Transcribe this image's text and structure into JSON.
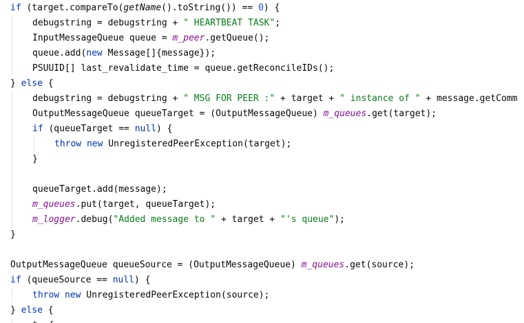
{
  "editor": {
    "lines": [
      {
        "indent": 0,
        "tokens": [
          {
            "t": "if",
            "c": "kw"
          },
          {
            "t": " (target.compareTo("
          },
          {
            "t": "getName",
            "c": "fn-italic"
          },
          {
            "t": "().toString()) == "
          },
          {
            "t": "0",
            "c": "num"
          },
          {
            "t": ") {"
          }
        ]
      },
      {
        "indent": 1,
        "tokens": [
          {
            "t": "debugstring = debugstring + "
          },
          {
            "t": "\" HEARTBEAT TASK\"",
            "c": "str"
          },
          {
            "t": ";"
          }
        ]
      },
      {
        "indent": 1,
        "tokens": [
          {
            "t": "InputMessageQueue queue = "
          },
          {
            "t": "m_peer",
            "c": "field"
          },
          {
            "t": ".getQueue();"
          }
        ]
      },
      {
        "indent": 1,
        "tokens": [
          {
            "t": "queue.add("
          },
          {
            "t": "new",
            "c": "kw"
          },
          {
            "t": " Message[]{message});"
          }
        ]
      },
      {
        "indent": 1,
        "tokens": [
          {
            "t": "PSUUID[] last_revalidate_time = queue.getReconcileIDs();"
          }
        ]
      },
      {
        "indent": 0,
        "tokens": [
          {
            "t": "} "
          },
          {
            "t": "else",
            "c": "kw"
          },
          {
            "t": " {"
          }
        ]
      },
      {
        "indent": 1,
        "tokens": [
          {
            "t": "debugstring = debugstring + "
          },
          {
            "t": "\" MSG FOR PEER :\"",
            "c": "str"
          },
          {
            "t": " + target + "
          },
          {
            "t": "\" instance of \"",
            "c": "str"
          },
          {
            "t": " + message.getComm"
          }
        ]
      },
      {
        "indent": 1,
        "tokens": [
          {
            "t": "OutputMessageQueue queueTarget = (OutputMessageQueue) "
          },
          {
            "t": "m_queues",
            "c": "field"
          },
          {
            "t": ".get(target);"
          }
        ]
      },
      {
        "indent": 1,
        "tokens": [
          {
            "t": "if",
            "c": "kw"
          },
          {
            "t": " (queueTarget == "
          },
          {
            "t": "null",
            "c": "kw"
          },
          {
            "t": ") {"
          }
        ]
      },
      {
        "indent": 2,
        "tokens": [
          {
            "t": "throw",
            "c": "kw"
          },
          {
            "t": " "
          },
          {
            "t": "new",
            "c": "kw"
          },
          {
            "t": " UnregisteredPeerException(target);"
          }
        ]
      },
      {
        "indent": 1,
        "tokens": [
          {
            "t": "}"
          }
        ]
      },
      {
        "indent": 1,
        "tokens": []
      },
      {
        "indent": 1,
        "tokens": [
          {
            "t": "queueTarget.add(message);"
          }
        ]
      },
      {
        "indent": 1,
        "tokens": [
          {
            "t": "m_queues",
            "c": "field"
          },
          {
            "t": ".put(target, queueTarget);"
          }
        ]
      },
      {
        "indent": 1,
        "tokens": [
          {
            "t": "m_logger",
            "c": "field"
          },
          {
            "t": ".debug("
          },
          {
            "t": "\"Added message to \"",
            "c": "str"
          },
          {
            "t": " + target + "
          },
          {
            "t": "\"'s queue\"",
            "c": "str"
          },
          {
            "t": ");"
          }
        ]
      },
      {
        "indent": 0,
        "tokens": [
          {
            "t": "}"
          }
        ]
      },
      {
        "indent": 0,
        "tokens": []
      },
      {
        "indent": 0,
        "tokens": [
          {
            "t": "OutputMessageQueue queueSource = (OutputMessageQueue) "
          },
          {
            "t": "m_queues",
            "c": "field"
          },
          {
            "t": ".get(source);"
          }
        ]
      },
      {
        "indent": 0,
        "tokens": [
          {
            "t": "if",
            "c": "kw"
          },
          {
            "t": " (queueSource == "
          },
          {
            "t": "null",
            "c": "kw"
          },
          {
            "t": ") {"
          }
        ]
      },
      {
        "indent": 1,
        "tokens": [
          {
            "t": "throw",
            "c": "kw"
          },
          {
            "t": " "
          },
          {
            "t": "new",
            "c": "kw"
          },
          {
            "t": " UnregisteredPeerException(source);"
          }
        ]
      },
      {
        "indent": 0,
        "tokens": [
          {
            "t": "} "
          },
          {
            "t": "else",
            "c": "kw"
          },
          {
            "t": " {"
          }
        ]
      },
      {
        "indent": 1,
        "tokens": [
          {
            "t": "t  {"
          }
        ]
      }
    ]
  },
  "colors": {
    "background": "#ffffff",
    "text": "#080808",
    "keyword": "#0033b3",
    "string": "#067d17",
    "field": "#871094",
    "number": "#1750eb",
    "indent_guide": "#e4e4e4"
  }
}
